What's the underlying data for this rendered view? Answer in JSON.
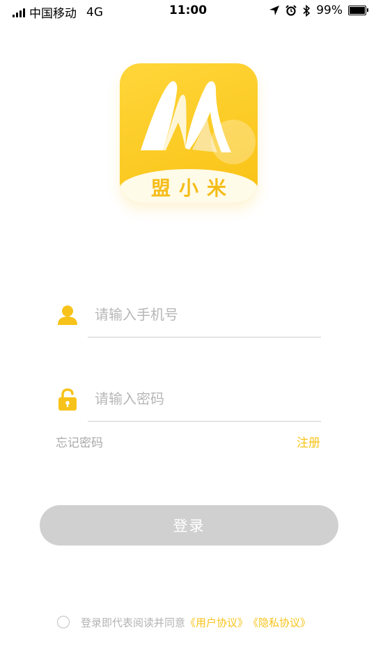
{
  "status_bar": {
    "carrier": "中国移动",
    "network": "4G",
    "time": "11:00",
    "battery": "99%",
    "icons": [
      "signal-icon",
      "location-arrow-icon",
      "alarm-icon",
      "bluetooth-icon",
      "battery-icon"
    ]
  },
  "logo": {
    "letter": "M",
    "text": "盟小米",
    "color": "#f9c214"
  },
  "form": {
    "phone_placeholder": "请输入手机号",
    "phone_value": "",
    "password_placeholder": "请输入密码",
    "password_value": "",
    "forgot_label": "忘记密码",
    "register_label": "注册",
    "login_label": "登录"
  },
  "agreement": {
    "text": "登录即代表阅读并同意",
    "user_agreement": "《用户协议》",
    "privacy_policy": "《隐私协议》"
  },
  "colors": {
    "accent": "#f7c31a",
    "button_disabled": "#d0d0d0",
    "placeholder": "#b7b7b7"
  }
}
